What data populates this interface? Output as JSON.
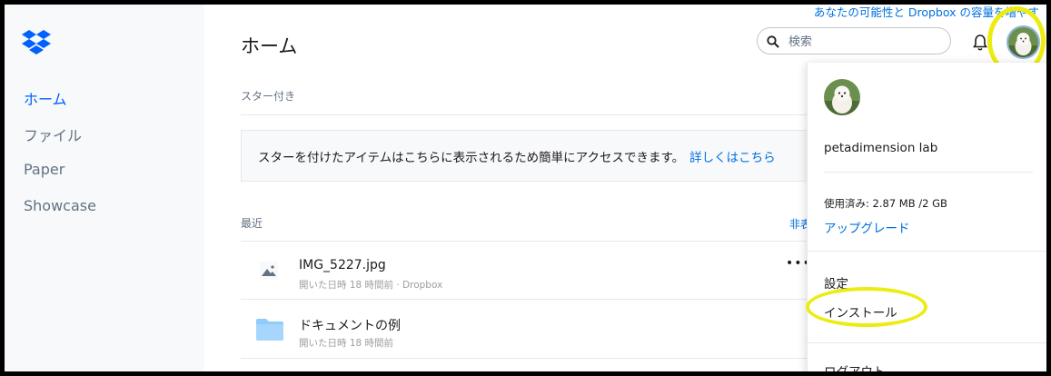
{
  "header": {
    "promo": "あなたの可能性と Dropbox の容量を増やす",
    "title": "ホーム",
    "search_placeholder": "検索"
  },
  "sidebar": {
    "items": [
      {
        "label": "ホーム",
        "active": true
      },
      {
        "label": "ファイル"
      },
      {
        "label": "Paper"
      },
      {
        "label": "Showcase"
      }
    ]
  },
  "starred": {
    "label": "スター付き",
    "notice": "スターを付けたアイテムはこちらに表示されるため簡単にアクセスできます。",
    "notice_link": "詳しくはこちら"
  },
  "recent": {
    "label": "最近",
    "hide_link": "非表",
    "items": [
      {
        "name": "IMG_5227.jpg",
        "meta": "開いた日時 18 時間前 · Dropbox",
        "icon": "image-file-icon",
        "more": "•••"
      },
      {
        "name": "ドキュメントの例",
        "meta": "開いた日時 18 時間前",
        "icon": "folder-icon"
      }
    ]
  },
  "account_menu": {
    "name": "petadimension lab",
    "usage": "使用済み: 2.87 MB /2 GB",
    "upgrade": "アップグレード",
    "settings": "設定",
    "install": "インストール",
    "logout": "ログアウト"
  },
  "colors": {
    "accent": "#0061fe",
    "link": "#0070e0",
    "highlight": "#ecec12",
    "folder": "#8fccfa"
  }
}
